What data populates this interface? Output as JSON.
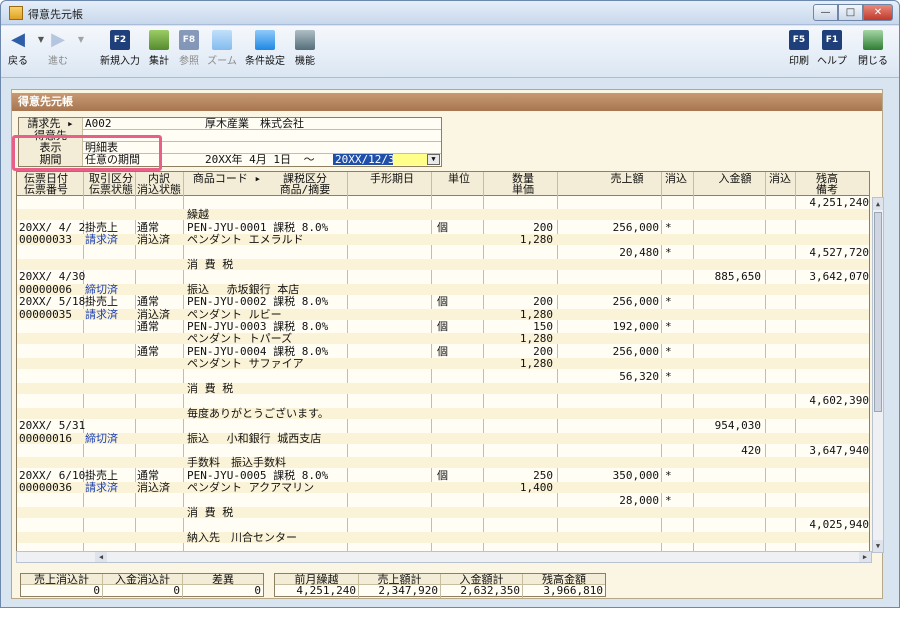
{
  "window": {
    "title": "得意先元帳",
    "minimize": "—",
    "maximize": "□",
    "close": "✕"
  },
  "toolbar": {
    "left": [
      {
        "key": "back",
        "icon": "◀",
        "label": "戻る",
        "disabled": false
      },
      {
        "key": "forward",
        "icon": "▶",
        "label": "進む",
        "disabled": true
      },
      {
        "key": "new",
        "icon": "F2",
        "label": "新規入力",
        "disabled": false
      },
      {
        "key": "total",
        "icon": "",
        "label": "集計",
        "disabled": false
      },
      {
        "key": "ref",
        "icon": "F8",
        "label": "参照",
        "disabled": true
      },
      {
        "key": "zoom",
        "icon": "",
        "label": "ズーム",
        "disabled": true
      },
      {
        "key": "cond",
        "icon": "",
        "label": "条件設定",
        "disabled": false
      },
      {
        "key": "func",
        "icon": "",
        "label": "機能",
        "disabled": false
      }
    ],
    "right": [
      {
        "key": "print",
        "icon": "F5",
        "label": "印刷"
      },
      {
        "key": "help",
        "icon": "F1",
        "label": "ヘルプ"
      },
      {
        "key": "close",
        "icon": "",
        "label": "閉じる"
      }
    ]
  },
  "panel": {
    "title": "得意先元帳"
  },
  "header": {
    "billing_label": "請求先 ▸",
    "billing_code": "A002",
    "billing_name": "厚木産業　株式会社",
    "customer_label": "得意先",
    "display_label": "表示",
    "display_value": "明細表",
    "period_label": "期間",
    "period_value": "任意の期間",
    "date_from": "20XX年 4月 1日",
    "date_sep": "～",
    "date_to": "20XX/12/31"
  },
  "columns": {
    "c1a": "伝票日付",
    "c1b": "伝票番号",
    "c2a": "取引区分",
    "c2b": "伝票状態",
    "c3a": "内訳",
    "c3b": "消込状態",
    "c4a": "商品コード ▸",
    "c4b": "",
    "c5a": "課税区分",
    "c5b": "商品/摘要",
    "c6": "手形期日",
    "c7": "単位",
    "c8a": "数量",
    "c8b": "単価",
    "c9": "売上額",
    "c10": "消込",
    "c11": "入金額",
    "c12": "消込",
    "c13a": "残高",
    "c13b": "備考"
  },
  "rows": [
    {
      "date": "",
      "type": "",
      "breakdown": "",
      "product": "",
      "qty": "",
      "amount": "",
      "flag": "",
      "paid": "",
      "balance": "4,251,240"
    },
    {
      "date": "",
      "type": "",
      "breakdown": "",
      "product": "繰越",
      "qty": "",
      "amount": "",
      "flag": "",
      "paid": "",
      "balance": ""
    },
    {
      "date": "20XX/ 4/ 2",
      "type": "掛売上",
      "breakdown": "通常",
      "product": "PEN-JYU-0001  課税 8.0%",
      "unit": "個",
      "qty": "200",
      "amount": "256,000",
      "flag": "*",
      "paid": "",
      "balance": ""
    },
    {
      "date": "00000033",
      "status": "請求済",
      "breakdown": "消込済",
      "product": "ペンダント エメラルド",
      "unit": "",
      "qty": "1,280",
      "amount": "",
      "flag": "",
      "paid": "",
      "balance": ""
    },
    {
      "date": "",
      "type": "",
      "breakdown": "",
      "product": "",
      "qty": "",
      "amount": "20,480",
      "flag": "*",
      "paid": "",
      "balance": "4,527,720"
    },
    {
      "date": "",
      "type": "",
      "breakdown": "",
      "product": "消 費 税",
      "qty": "",
      "amount": "",
      "flag": "",
      "paid": "",
      "balance": ""
    },
    {
      "date": "20XX/ 4/30",
      "type": "",
      "breakdown": "",
      "product": "",
      "qty": "",
      "amount": "",
      "flag": "",
      "paid": "885,650",
      "balance": "3,642,070"
    },
    {
      "date": "00000006",
      "status": "締切済",
      "breakdown": "",
      "product": "振込　 赤坂銀行 本店",
      "qty": "",
      "amount": "",
      "flag": "",
      "paid": "",
      "balance": ""
    },
    {
      "date": "20XX/ 5/18",
      "type": "掛売上",
      "breakdown": "通常",
      "product": "PEN-JYU-0002  課税 8.0%",
      "unit": "個",
      "qty": "200",
      "amount": "256,000",
      "flag": "*",
      "paid": "",
      "balance": ""
    },
    {
      "date": "00000035",
      "status": "請求済",
      "breakdown": "消込済",
      "product": "ペンダント ルビー",
      "unit": "",
      "qty": "1,280",
      "amount": "",
      "flag": "",
      "paid": "",
      "balance": ""
    },
    {
      "date": "",
      "type": "",
      "breakdown": "通常",
      "product": "PEN-JYU-0003  課税 8.0%",
      "unit": "個",
      "qty": "150",
      "amount": "192,000",
      "flag": "*",
      "paid": "",
      "balance": ""
    },
    {
      "date": "",
      "type": "",
      "breakdown": "",
      "product": "ペンダント トパーズ",
      "unit": "",
      "qty": "1,280",
      "amount": "",
      "flag": "",
      "paid": "",
      "balance": ""
    },
    {
      "date": "",
      "type": "",
      "breakdown": "通常",
      "product": "PEN-JYU-0004  課税 8.0%",
      "unit": "個",
      "qty": "200",
      "amount": "256,000",
      "flag": "*",
      "paid": "",
      "balance": ""
    },
    {
      "date": "",
      "type": "",
      "breakdown": "",
      "product": "ペンダント サファイア",
      "unit": "",
      "qty": "1,280",
      "amount": "",
      "flag": "",
      "paid": "",
      "balance": ""
    },
    {
      "date": "",
      "type": "",
      "breakdown": "",
      "product": "",
      "qty": "",
      "amount": "56,320",
      "flag": "*",
      "paid": "",
      "balance": ""
    },
    {
      "date": "",
      "type": "",
      "breakdown": "",
      "product": "消 費 税",
      "qty": "",
      "amount": "",
      "flag": "",
      "paid": "",
      "balance": ""
    },
    {
      "date": "",
      "type": "",
      "breakdown": "",
      "product": "",
      "qty": "",
      "amount": "",
      "flag": "",
      "paid": "",
      "balance": "4,602,390"
    },
    {
      "date": "",
      "type": "",
      "breakdown": "",
      "product": "毎度ありがとうございます。",
      "qty": "",
      "amount": "",
      "flag": "",
      "paid": "",
      "balance": ""
    },
    {
      "date": "20XX/ 5/31",
      "type": "",
      "breakdown": "",
      "product": "",
      "qty": "",
      "amount": "",
      "flag": "",
      "paid": "954,030",
      "balance": ""
    },
    {
      "date": "00000016",
      "status": "締切済",
      "breakdown": "",
      "product": "振込　 小和銀行 城西支店",
      "qty": "",
      "amount": "",
      "flag": "",
      "paid": "",
      "balance": ""
    },
    {
      "date": "",
      "type": "",
      "breakdown": "",
      "product": "",
      "qty": "",
      "amount": "",
      "flag": "",
      "paid": "420",
      "balance": "3,647,940"
    },
    {
      "date": "",
      "type": "",
      "breakdown": "",
      "product": "手数料　振込手数料",
      "qty": "",
      "amount": "",
      "flag": "",
      "paid": "",
      "balance": ""
    },
    {
      "date": "20XX/ 6/10",
      "type": "掛売上",
      "breakdown": "通常",
      "product": "PEN-JYU-0005  課税 8.0%",
      "unit": "個",
      "qty": "250",
      "amount": "350,000",
      "flag": "*",
      "paid": "",
      "balance": ""
    },
    {
      "date": "00000036",
      "status": "請求済",
      "breakdown": "消込済",
      "product": "ペンダント アクアマリン",
      "unit": "",
      "qty": "1,400",
      "amount": "",
      "flag": "",
      "paid": "",
      "balance": ""
    },
    {
      "date": "",
      "type": "",
      "breakdown": "",
      "product": "",
      "qty": "",
      "amount": "28,000",
      "flag": "*",
      "paid": "",
      "balance": ""
    },
    {
      "date": "",
      "type": "",
      "breakdown": "",
      "product": "消 費 税",
      "qty": "",
      "amount": "",
      "flag": "",
      "paid": "",
      "balance": ""
    },
    {
      "date": "",
      "type": "",
      "breakdown": "",
      "product": "",
      "qty": "",
      "amount": "",
      "flag": "",
      "paid": "",
      "balance": "4,025,940"
    },
    {
      "date": "",
      "type": "",
      "breakdown": "",
      "product": "納入先　川合センター",
      "qty": "",
      "amount": "",
      "flag": "",
      "paid": "",
      "balance": ""
    }
  ],
  "totals_left": [
    {
      "label": "売上消込計",
      "value": "0"
    },
    {
      "label": "入金消込計",
      "value": "0"
    },
    {
      "label": "差異",
      "value": "0"
    }
  ],
  "totals_right": [
    {
      "label": "前月繰越",
      "value": "4,251,240"
    },
    {
      "label": "売上額計",
      "value": "2,347,920"
    },
    {
      "label": "入金額計",
      "value": "2,632,350"
    },
    {
      "label": "残高金額",
      "value": "3,966,810"
    }
  ],
  "colors": {
    "accent_selection": "#1f4fa8",
    "highlight_box": "#e85f88",
    "panel_head": "#b5835d",
    "link": "#1a3fb5"
  }
}
